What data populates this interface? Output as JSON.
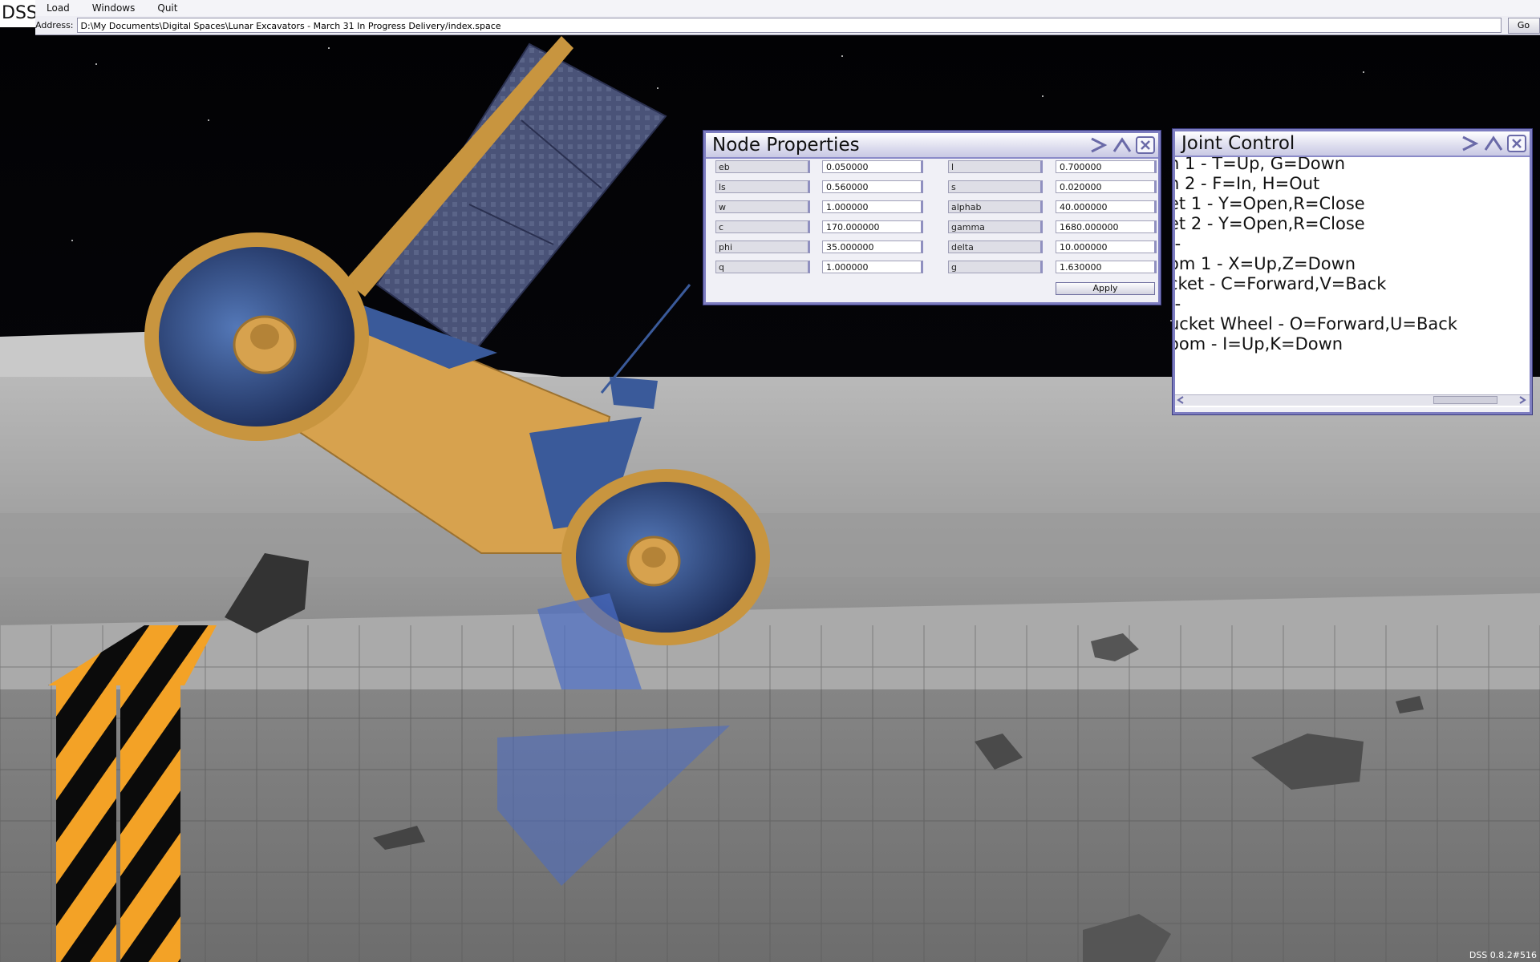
{
  "app": {
    "logo": "DSS",
    "version": "DSS 0.8.2#516"
  },
  "menu": {
    "items": [
      "Load",
      "Windows",
      "Quit"
    ]
  },
  "address": {
    "label": "Address:",
    "value": "D:\\My Documents\\Digital Spaces\\Lunar Excavators - March 31 In Progress Delivery/index.space",
    "go_label": "Go"
  },
  "node_properties": {
    "title": "Node Properties",
    "rows": [
      {
        "l1": "eb",
        "v1": "0.050000",
        "l2": "l",
        "v2": "0.700000"
      },
      {
        "l1": "ls",
        "v1": "0.560000",
        "l2": "s",
        "v2": "0.020000"
      },
      {
        "l1": "w",
        "v1": "1.000000",
        "l2": "alphab",
        "v2": "40.000000"
      },
      {
        "l1": "c",
        "v1": "170.000000",
        "l2": "gamma",
        "v2": "1680.000000"
      },
      {
        "l1": "phi",
        "v1": "35.000000",
        "l2": "delta",
        "v2": "10.000000"
      },
      {
        "l1": "q",
        "v1": "1.000000",
        "l2": "g",
        "v2": "1.630000"
      }
    ],
    "apply_label": "Apply"
  },
  "joint_control": {
    "title": "Joint Control",
    "lines": [
      "n 1 - T=Up, G=Down",
      "n 2 - F=In, H=Out",
      "et 1 - Y=Open,R=Close",
      "et 2 - Y=Open,R=Close",
      "--",
      "om 1 - X=Up,Z=Down",
      "cket - C=Forward,V=Back",
      "--",
      "ucket Wheel - O=Forward,U=Back",
      "oom - I=Up,K=Down"
    ]
  },
  "colors": {
    "panel_border": "#7d7dc0",
    "excavator_gold": "#d7a24e",
    "excavator_blue": "#3a5a9a",
    "hazard_orange": "#f0a020"
  },
  "icons": {
    "expand": "chevron-right-icon",
    "collapse": "chevron-up-icon",
    "close": "close-icon"
  }
}
